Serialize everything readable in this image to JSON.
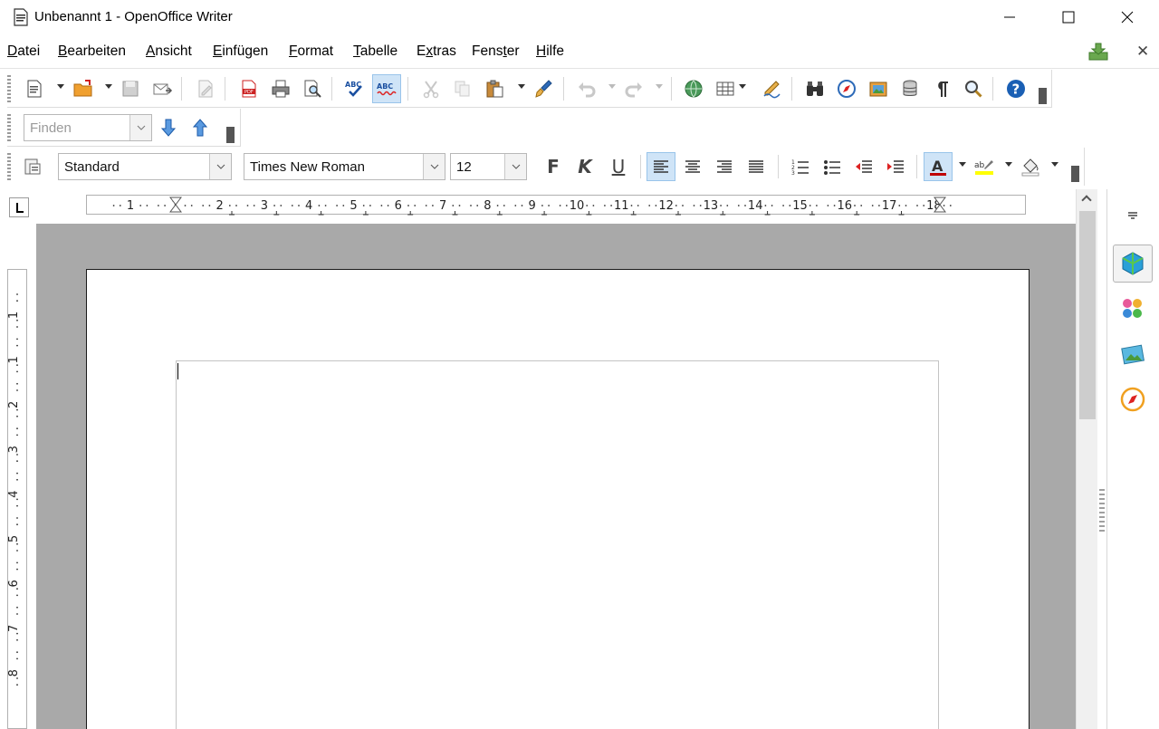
{
  "window": {
    "title": "Unbenannt 1 - OpenOffice Writer",
    "minimize_icon": "minimize-icon",
    "maximize_icon": "maximize-icon",
    "close_icon": "close-icon"
  },
  "menu": {
    "items": [
      {
        "pre": "",
        "u": "D",
        "post": "atei"
      },
      {
        "pre": "",
        "u": "B",
        "post": "earbeiten"
      },
      {
        "pre": "",
        "u": "A",
        "post": "nsicht"
      },
      {
        "pre": "",
        "u": "E",
        "post": "infügen"
      },
      {
        "pre": "",
        "u": "F",
        "post": "ormat"
      },
      {
        "pre": "",
        "u": "T",
        "post": "abelle"
      },
      {
        "pre": "E",
        "u": "x",
        "post": "tras"
      },
      {
        "pre": "Fens",
        "u": "t",
        "post": "er"
      },
      {
        "pre": "",
        "u": "H",
        "post": "ilfe"
      }
    ],
    "close_document": "✕"
  },
  "find_toolbar": {
    "placeholder": "Finden"
  },
  "formatting": {
    "paragraph_style": "Standard",
    "font_name": "Times New Roman",
    "font_size": "12",
    "bold_label": "F",
    "italic_label": "K",
    "underline_label": "U"
  },
  "ruler": {
    "horizontal_labels": [
      "1",
      "1",
      "2",
      "3",
      "4",
      "5",
      "6",
      "7",
      "8",
      "9",
      "10",
      "11",
      "12",
      "13",
      "14",
      "15",
      "16",
      "17",
      "18"
    ],
    "vertical_labels": [
      "1",
      "1",
      "2",
      "3",
      "4",
      "5",
      "6",
      "7",
      "8"
    ]
  },
  "colors": {
    "active_button": "#cfe4f7",
    "canvas": "#a9a9a9",
    "font_color_bar": "#c00000",
    "highlight_bar": "#ffff00"
  }
}
